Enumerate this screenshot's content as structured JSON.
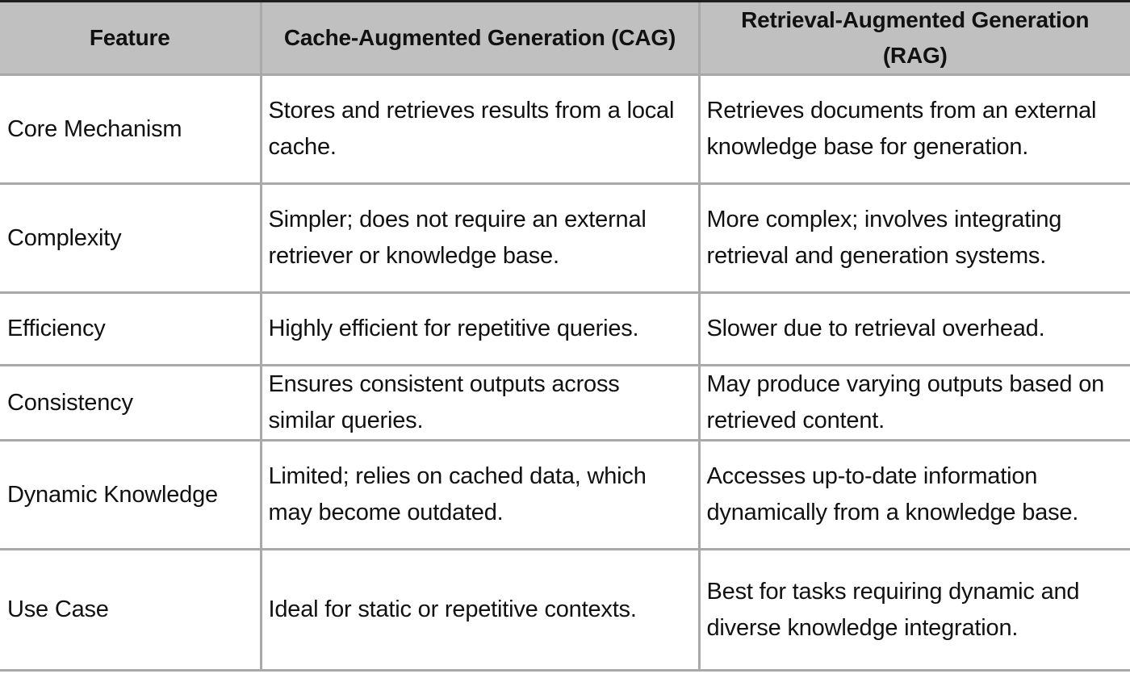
{
  "table": {
    "headers": [
      "Feature",
      "Cache-Augmented Generation (CAG)",
      "Retrieval-Augmented Generation (RAG)"
    ],
    "header_colors": {
      "header_background": "#c0c0c0",
      "grid_lines": "#a9a9a9",
      "top_rule": "#1e1e1e"
    },
    "rows": [
      {
        "feature": "Core Mechanism",
        "cag": "Stores and retrieves results from a local cache.",
        "rag": "Retrieves documents from an external knowledge base for generation."
      },
      {
        "feature": "Complexity",
        "cag": "Simpler; does not require an external retriever or knowledge base.",
        "rag": "More complex; involves integrating retrieval and generation systems."
      },
      {
        "feature": "Efficiency",
        "cag": "Highly efficient for repetitive queries.",
        "rag": "Slower due to retrieval overhead."
      },
      {
        "feature": "Consistency",
        "cag": "Ensures consistent outputs across similar queries.",
        "rag": "May produce varying outputs based on retrieved content."
      },
      {
        "feature": "Dynamic Knowledge",
        "cag": "Limited; relies on cached data, which may become outdated.",
        "rag": "Accesses up-to-date information dynamically from a knowledge base."
      },
      {
        "feature": "Use Case",
        "cag": "Ideal for static or repetitive contexts.",
        "rag": "Best for tasks requiring dynamic and diverse knowledge integration."
      }
    ]
  }
}
